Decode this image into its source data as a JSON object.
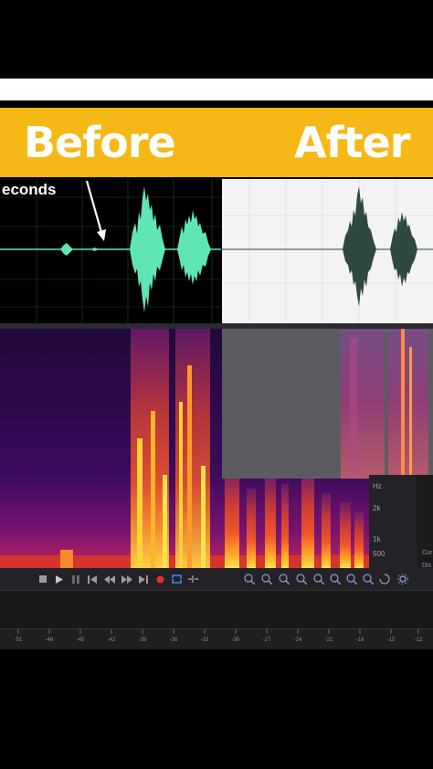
{
  "banner": {
    "before_label": "Before",
    "after_label": "After",
    "color": "#f6b817"
  },
  "annotation": {
    "text": "econds"
  },
  "frequency_axis": {
    "ticks": [
      "Hz",
      "2k",
      "1k",
      "500"
    ]
  },
  "side_panel": {
    "labels": [
      "Cur",
      "Dis"
    ]
  },
  "transport": {
    "buttons": [
      "stop-icon",
      "play-icon",
      "pause-icon",
      "skip-to-start-icon",
      "rewind-icon",
      "fast-forward-icon",
      "skip-to-end-icon",
      "record-icon",
      "loop-icon",
      "skip-selection-icon"
    ],
    "zoom_buttons": [
      "zoom-in-amplitude-icon",
      "zoom-out-amplitude-icon",
      "zoom-to-selection-icon",
      "zoom-in-time-icon",
      "zoom-out-time-icon",
      "zoom-full-icon",
      "zoom-in-frequency-icon",
      "zoom-out-frequency-icon",
      "reset-zoom-icon",
      "settings-icon"
    ]
  },
  "timeline": {
    "ticks": [
      "-51",
      "-48",
      "-45",
      "-42",
      "-39",
      "-36",
      "-33",
      "-30",
      "-27",
      "-24",
      "-21",
      "-18",
      "-15",
      "-12"
    ]
  },
  "colors": {
    "before_waveform": "#5fe6b4",
    "after_waveform": "#2e4a40",
    "spectrogram_hot": "#ffd23a",
    "spectrogram_cold": "#2a0a45"
  }
}
